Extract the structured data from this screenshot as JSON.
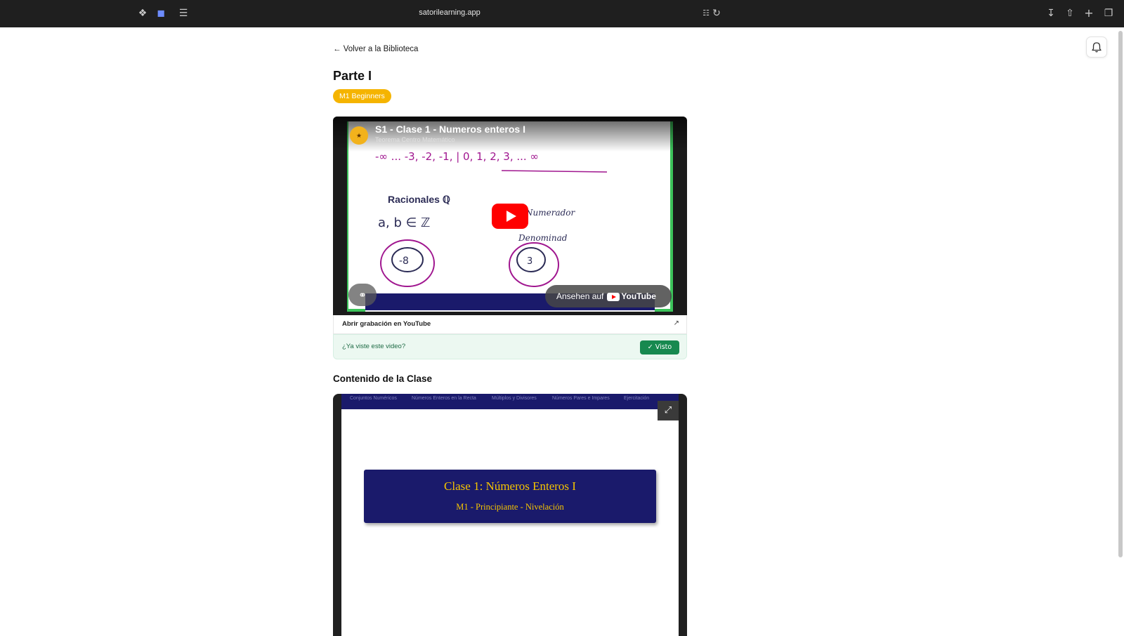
{
  "browser": {
    "url": "satorilearning.app",
    "icons": [
      "extension-icon",
      "shield-icon",
      "reader-icon",
      "translate-icon",
      "reload-icon",
      "download-icon",
      "share-icon",
      "new-tab-icon",
      "tabs-overview-icon"
    ]
  },
  "page": {
    "back_label": "← Volver a la Biblioteca",
    "title": "Parte I",
    "badge": "M1 Beginners",
    "notification_icon": "bell-icon"
  },
  "video": {
    "title": "S1 - Clase 1 - Numeros enteros I",
    "channel": "Teorema Centro Matemático",
    "watch_on": "Ansehen auf",
    "youtube_word": "YouTube",
    "board": {
      "number_line": "-∞ ... -3, -2, -1, | 0, 1, 2, 3, ... ∞",
      "heading": "Racionales ℚ",
      "set_expr": "a, b ∈ ℤ",
      "numerator": "Numerador",
      "denominator": "Denominad",
      "circle_left": "-8",
      "circle_right": "3"
    },
    "open_label": "Abrir grabación en YouTube",
    "seen_question": "¿Ya viste este video?",
    "seen_button": "✓  Visto"
  },
  "content": {
    "section_title": "Contenido de la Clase",
    "nav": [
      "Conjuntos Numéricos",
      "Números Enteros en la Recta",
      "Múltiplos y Divisores",
      "Números Pares e Impares",
      "Ejercitación"
    ],
    "slide_title": "Clase 1:  Números Enteros I",
    "slide_subtitle": "M1 - Principiante - Nivelación"
  },
  "colors": {
    "badge": "#f5b400",
    "accent_green": "#17894f",
    "slide_navy": "#1a1a6b",
    "slide_gold": "#f5c400",
    "youtube_red": "#ff0000"
  }
}
